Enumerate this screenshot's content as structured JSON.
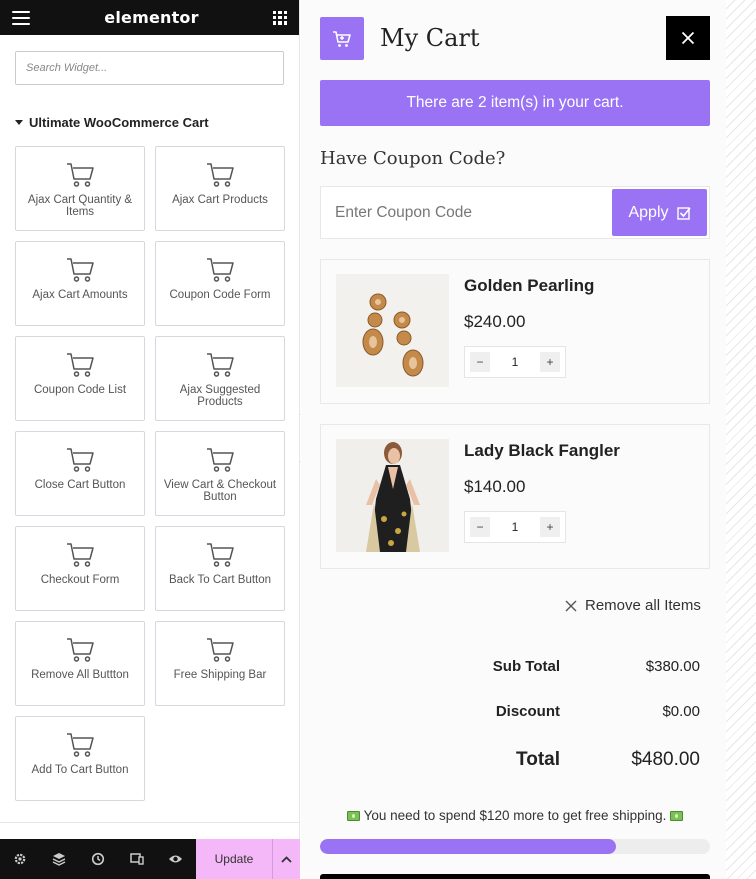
{
  "editor": {
    "brand": "elementor",
    "search_placeholder": "Search Widget...",
    "category_title": "Ultimate WooCommerce Cart",
    "widgets": [
      {
        "label": "Ajax Cart Quantity & Items"
      },
      {
        "label": "Ajax Cart Products"
      },
      {
        "label": "Ajax Cart Amounts"
      },
      {
        "label": "Coupon Code Form"
      },
      {
        "label": "Coupon Code List"
      },
      {
        "label": "Ajax Suggested Products"
      },
      {
        "label": "Close Cart Button"
      },
      {
        "label": "View Cart & Checkout Button"
      },
      {
        "label": "Checkout Form"
      },
      {
        "label": "Back To Cart Button"
      },
      {
        "label": "Remove All Buttton"
      },
      {
        "label": "Free Shipping Bar"
      },
      {
        "label": "Add To Cart Button"
      }
    ],
    "footer": {
      "icons": [
        "settings-icon",
        "layers-icon",
        "history-icon",
        "responsive-icon",
        "eye-icon"
      ],
      "update_label": "Update"
    }
  },
  "cart": {
    "title": "My Cart",
    "items_message": "There are 2 item(s) in your cart.",
    "coupon": {
      "heading": "Have Coupon Code?",
      "placeholder": "Enter Coupon Code",
      "apply_label": "Apply"
    },
    "products": [
      {
        "name": "Golden Pearling",
        "price": "$240.00",
        "qty": "1",
        "image_icon": "earrings-image",
        "minus": "−",
        "plus": "+"
      },
      {
        "name": "Lady Black Fangler",
        "price": "$140.00",
        "qty": "1",
        "image_icon": "dress-model-image",
        "minus": "−",
        "plus": "+"
      }
    ],
    "remove_all_label": "Remove all Items",
    "totals": {
      "subtotal_label": "Sub Total",
      "subtotal_value": "$380.00",
      "discount_label": "Discount",
      "discount_value": "$0.00",
      "total_label": "Total",
      "total_value": "$480.00"
    },
    "shipping": {
      "message": "You need to spend $120 more to get free shipping.",
      "progress_fraction": 0.76
    }
  },
  "colors": {
    "accent": "#9a73f5",
    "update_button": "#f4b7f7",
    "header_bg": "#111111"
  }
}
